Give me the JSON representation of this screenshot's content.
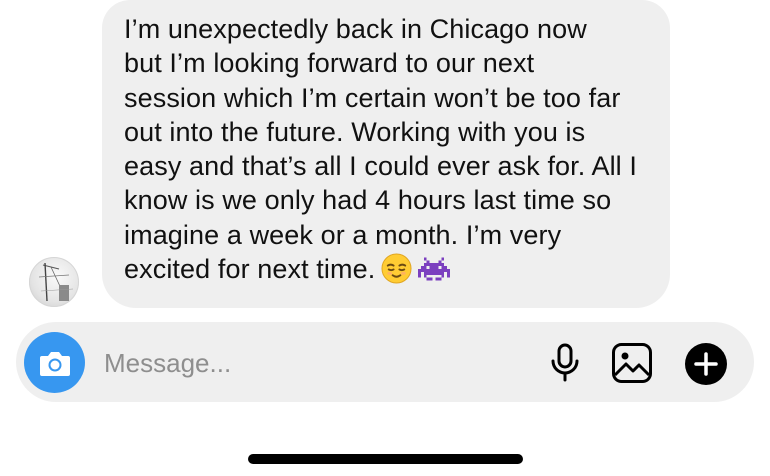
{
  "conversation": {
    "incoming_message": {
      "text": "I’m unexpectedly back in Chicago now\nbut I’m looking forward to our next\nsession which I’m certain won’t be too far\nout into the future. Working with you is\neasy and that’s all I could ever ask for. All I\nknow is we only had 4 hours last time so\nimagine a week or a month. I’m very\nexcited for next time.",
      "emojis": [
        "relieved-face-emoji",
        "alien-monster-emoji"
      ]
    },
    "sender_avatar": "avatar-photo"
  },
  "composer": {
    "placeholder": "Message...",
    "value": "",
    "icons": {
      "camera": "camera-icon",
      "mic": "microphone-icon",
      "gallery": "gallery-icon",
      "more": "plus-icon"
    }
  },
  "colors": {
    "bubble": "#efefef",
    "accent": "#3797f0",
    "text": "#111111",
    "placeholder": "#8e8e8e"
  }
}
